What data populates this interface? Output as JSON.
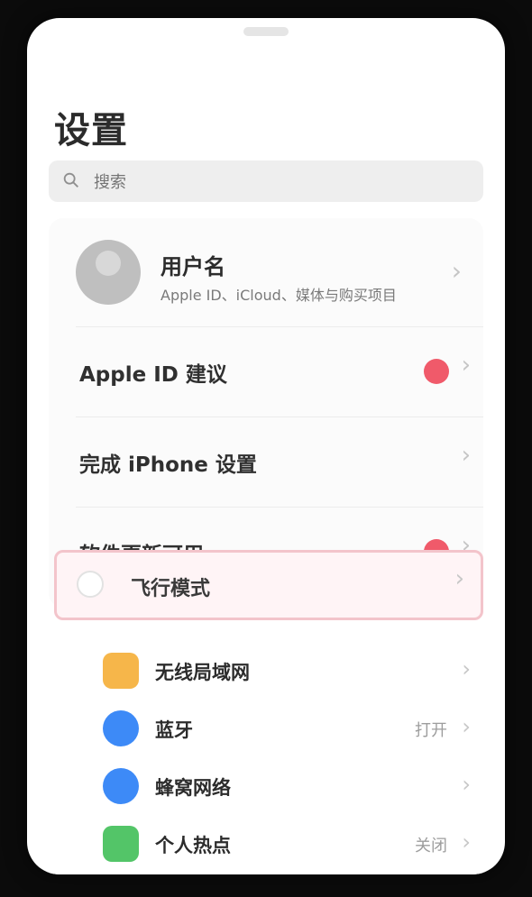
{
  "screen": {
    "title": "设置",
    "search_placeholder": "搜索"
  },
  "profile": {
    "name": "用户名",
    "subtitle": "Apple ID、iCloud、媒体与购买项目"
  },
  "menu_rows": [
    {
      "label": "Apple ID 建议",
      "badge": true
    },
    {
      "label": "完成 iPhone 设置",
      "badge": false
    },
    {
      "label": "软件更新可用",
      "badge": true
    }
  ],
  "highlight_row": {
    "label": "飞行模式"
  },
  "settings": [
    {
      "label": "无线局域网",
      "value": "",
      "color": "#f6b64a"
    },
    {
      "label": "蓝牙",
      "value": "打开",
      "color": "#3d8af7"
    },
    {
      "label": "蜂窝网络",
      "value": "",
      "color": "#3d8af7"
    },
    {
      "label": "个人热点",
      "value": "关闭",
      "color": "#53c568"
    }
  ],
  "icons": {
    "search": "search-icon",
    "chevron": "chevron-right-icon"
  }
}
